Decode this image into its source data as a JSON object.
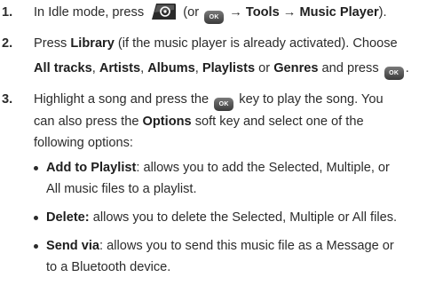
{
  "steps": [
    {
      "number": "1.",
      "parts": [
        "In Idle mode, press",
        "(or",
        "→",
        "Tools",
        "→",
        "Music Player",
        ")."
      ],
      "key_label": "OK"
    },
    {
      "number": "2.",
      "line1": [
        "Press",
        "Library",
        "(if the music player is already activated). Choose"
      ],
      "line2": [
        "All tracks",
        ",",
        "Artists",
        ",",
        "Albums",
        ",",
        "Playlists",
        "or",
        "Genres",
        "and press",
        "."
      ],
      "key_label": "OK"
    },
    {
      "number": "3.",
      "line1": [
        "Highlight a song and press the",
        "key to play the song. You"
      ],
      "line2": "can also press the",
      "line2_bold": "Options",
      "line2_tail": "soft key and select one of the",
      "line3": "following options:",
      "key_label": "OK",
      "bullets": [
        {
          "title": "Add to Playlist",
          "text": ": allows you to add the Selected, Multiple, or",
          "text2": "All music files to a playlist."
        },
        {
          "title": "Delete:",
          "text": " allows you to delete the Selected, Multiple or All files.",
          "text2": ""
        },
        {
          "title": "Send via",
          "text": ": allows you to send this music file as a Message or",
          "text2": "to a Bluetooth device."
        }
      ]
    }
  ]
}
